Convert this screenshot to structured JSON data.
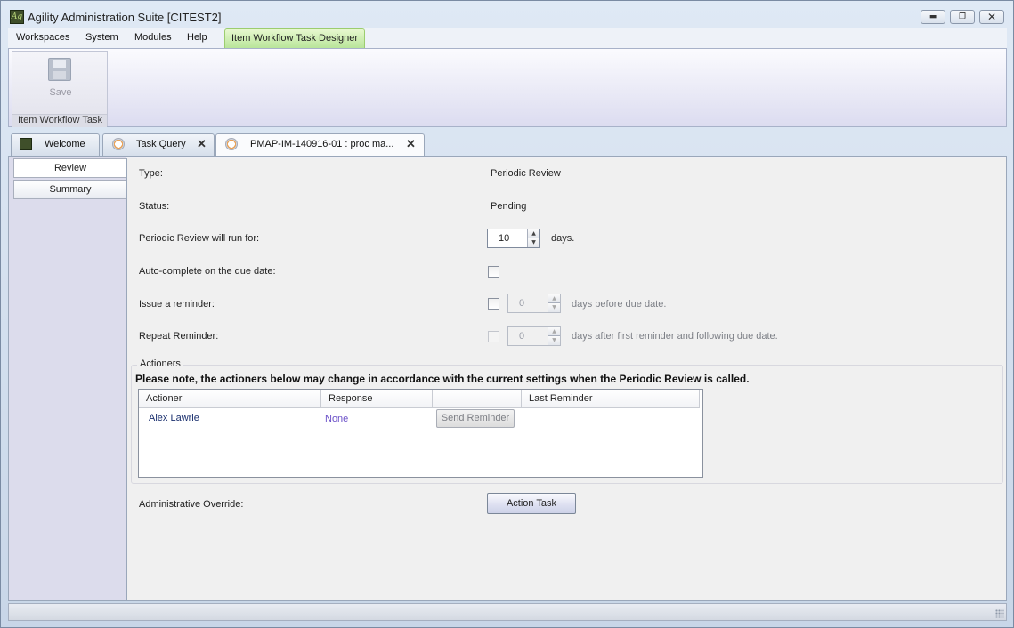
{
  "window": {
    "title": "Agility Administration Suite [CITEST2]"
  },
  "menu": {
    "items": [
      "Workspaces",
      "System",
      "Modules",
      "Help"
    ],
    "active": "Item Workflow Task Designer"
  },
  "ribbon": {
    "save_label": "Save",
    "group_label": "Item Workflow Task"
  },
  "tabs": [
    {
      "label": "Welcome"
    },
    {
      "label": "Task Query"
    },
    {
      "label": "PMAP-IM-140916-01 : proc ma..."
    }
  ],
  "sidebar": {
    "items": [
      "Review",
      "Summary"
    ]
  },
  "form": {
    "type_label": "Type:",
    "type_value": "Periodic Review",
    "status_label": "Status:",
    "status_value": "Pending",
    "run_label": "Periodic Review will run for:",
    "run_value": "10",
    "run_suffix": "days.",
    "autocomplete_label": "Auto-complete on the due date:",
    "reminder_label": "Issue a reminder:",
    "reminder_value": "0",
    "reminder_suffix": "days before due date.",
    "repeat_label": "Repeat Reminder:",
    "repeat_value": "0",
    "repeat_suffix": "days after first reminder and following due date."
  },
  "actioners": {
    "title": "Actioners",
    "note": "Please note, the actioners below may change in accordance with the current settings when the Periodic Review is called.",
    "columns": [
      "Actioner",
      "Response",
      "",
      "Last Reminder"
    ],
    "rows": [
      {
        "actioner": "Alex Lawrie",
        "response": "None",
        "button": "Send Reminder",
        "last_reminder": ""
      }
    ]
  },
  "override": {
    "label": "Administrative Override:",
    "button": "Action Task"
  },
  "colors": {
    "actioner_name": "#1a2f6e",
    "response_value": "#6a4fc8",
    "active_menu": "#c4ecaa"
  },
  "icons": [
    "app-logo-icon",
    "minimize-icon",
    "restore-icon",
    "close-icon",
    "save-icon",
    "clock-icon",
    "tab-close-icon",
    "spinner-up-icon",
    "spinner-down-icon",
    "resize-grip-icon"
  ]
}
